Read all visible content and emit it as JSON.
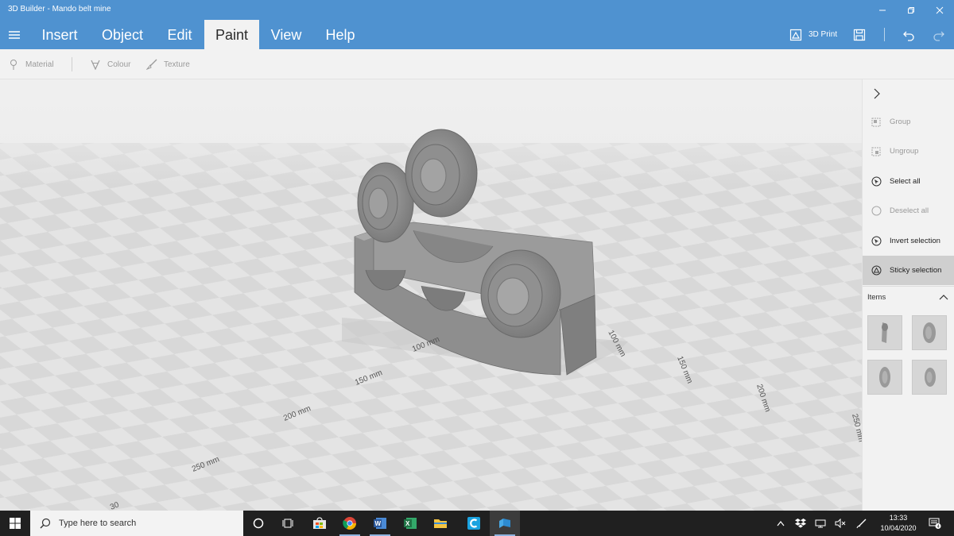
{
  "window": {
    "title": "3D Builder - Mando belt mine"
  },
  "menu": {
    "tabs": [
      "Insert",
      "Object",
      "Edit",
      "Paint",
      "View",
      "Help"
    ],
    "active_tab": "Paint",
    "print_label": "3D Print"
  },
  "toolbar": {
    "material_label": "Material",
    "colour_label": "Colour",
    "texture_label": "Texture"
  },
  "viewport": {
    "dim_labels": [
      "100 mm",
      "150 mm",
      "200 mm",
      "250 mm",
      "30",
      "100 mm",
      "150 mm",
      "200 mm",
      "250 mm",
      "100 mm"
    ]
  },
  "panel": {
    "group_label": "Group",
    "ungroup_label": "Ungroup",
    "select_all_label": "Select all",
    "deselect_all_label": "Deselect all",
    "invert_label": "Invert selection",
    "sticky_label": "Sticky selection",
    "items_label": "Items"
  },
  "taskbar": {
    "search_placeholder": "Type here to search",
    "time": "13:33",
    "date": "10/04/2020",
    "notification_count": "4"
  },
  "colors": {
    "accent": "#4f92d0",
    "taskbar": "#202020",
    "model": "#8e8e8e"
  }
}
